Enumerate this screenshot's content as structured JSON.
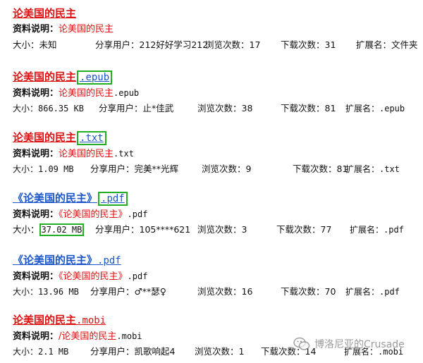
{
  "results": [
    {
      "title": "论美国的民主",
      "ext": "",
      "desc_label": "资料说明：",
      "desc_red": "论美国的民主",
      "desc_suffix": "",
      "size": "大小：未知",
      "sharer": "分享用户：212好好学习212",
      "views": "浏览次数：17",
      "downloads": "下载次数：31",
      "ext_name": "扩展名：文件夹"
    },
    {
      "title": "论美国的民主",
      "ext": ".epub",
      "desc_label": "资料说明：",
      "desc_red": "论美国的民主",
      "desc_suffix": ".epub",
      "size": "大小：866.35 KB",
      "sharer": "分享用户：止*佳武",
      "views": "浏览次数：38",
      "downloads": "下载次数：81",
      "ext_name": "扩展名：.epub"
    },
    {
      "title": "论美国的民主",
      "ext": ".txt",
      "desc_label": "资料说明：",
      "desc_red": "论美国的民主",
      "desc_suffix": ".txt",
      "size": "大小：1.09 MB",
      "sharer": "分享用户：完美**光辉",
      "views": "浏览次数：9",
      "downloads": "下载次数：81",
      "ext_name": "扩展名：.txt"
    },
    {
      "title": "《论美国的民主》",
      "ext": ".pdf",
      "desc_label": "资料说明：",
      "desc_red": "《论美国的民主》",
      "desc_suffix": ".pdf",
      "size_label": "大小：",
      "size_value": "37.02 MB",
      "sharer": "分享用户：105****621",
      "views": "浏览次数：3",
      "downloads": "下载次数：77",
      "ext_name": "扩展名：.pdf"
    },
    {
      "title": "《论美国的民主》",
      "ext": ".pdf",
      "desc_label": "资料说明：",
      "desc_red": "《论美国的民主》",
      "desc_suffix": ".pdf",
      "size": "大小：13.96 MB",
      "sharer": "分享用户：♂**瑟♀",
      "views": "浏览次数：16",
      "downloads": "下载次数：70",
      "ext_name": "扩展名：.pdf"
    },
    {
      "title": "论美国的民主",
      "ext": ".mobi",
      "desc_label": "资料说明：",
      "desc_red": "/论美国的民主",
      "desc_suffix": ".mobi",
      "size": "大小：2.1 MB",
      "sharer": "分享用户：凯歌响起4",
      "views": "浏览次数：1",
      "downloads": "下载次数：14",
      "ext_name": "扩展名：.mobi"
    }
  ],
  "watermark": {
    "text": "博洛尼亚的Crusade",
    "icon": "wechat-icon"
  },
  "colors": {
    "title_red": "#dd1111",
    "title_blue": "#1a56c8",
    "highlight_green": "#22b022"
  }
}
